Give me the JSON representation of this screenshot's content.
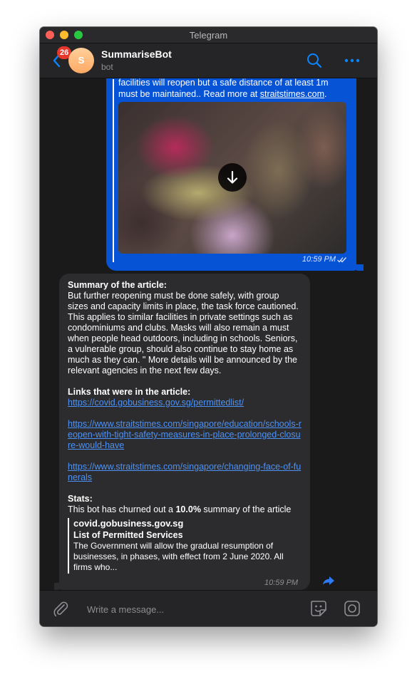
{
  "window": {
    "title": "Telegram"
  },
  "header": {
    "unread_count": "26",
    "avatar_initial": "S",
    "bot_name": "SummariseBot",
    "bot_status": "bot"
  },
  "outgoing": {
    "text_lead": "facilities will reopen but a safe distance of at least 1m must be maintained.. Read more at ",
    "link_text": "straitstimes.com",
    "text_tail": ".",
    "time": "10:59 PM"
  },
  "incoming": {
    "summary_heading": "Summary of the article:",
    "summary_body": "But further reopening must be done safely, with group sizes and capacity limits in place, the task force cautioned. This applies to similar facilities in private settings such as condominiums and clubs. Masks will also remain a must when people head outdoors, including in schools. Seniors, a vulnerable group, should also continue to stay home as much as they can. \" More details will be announced by the relevant agencies in the next few days.",
    "links_heading": "Links that were in the article:",
    "links": [
      "https://covid.gobusiness.gov.sg/permittedlist/",
      "https://www.straitstimes.com/singapore/education/schools-reopen-with-tight-safety-measures-in-place-prolonged-closure-would-have",
      "https://www.straitstimes.com/singapore/changing-face-of-funerals"
    ],
    "stats_heading": "Stats:",
    "stats_prefix": "This bot has churned out a ",
    "stats_value": "10.0%",
    "stats_suffix": " summary of the article",
    "preview": {
      "site": "covid.gobusiness.gov.sg",
      "title": "List of Permitted Services",
      "description": "The Government will allow the gradual resumption of businesses, in phases, with effect from 2 June 2020. All firms who..."
    },
    "time": "10:59 PM"
  },
  "composer": {
    "placeholder": "Write a message..."
  },
  "colors": {
    "accent": "#0a84ff",
    "outgoing_bubble": "#0753d6",
    "incoming_bubble": "#2c2c2e",
    "badge": "#e5372b",
    "link": "#4d92f5"
  },
  "icons": [
    "back-chevron-icon",
    "search-icon",
    "more-icon",
    "download-icon",
    "double-check-icon",
    "share-icon",
    "paperclip-icon",
    "sticker-icon",
    "camera-icon"
  ]
}
